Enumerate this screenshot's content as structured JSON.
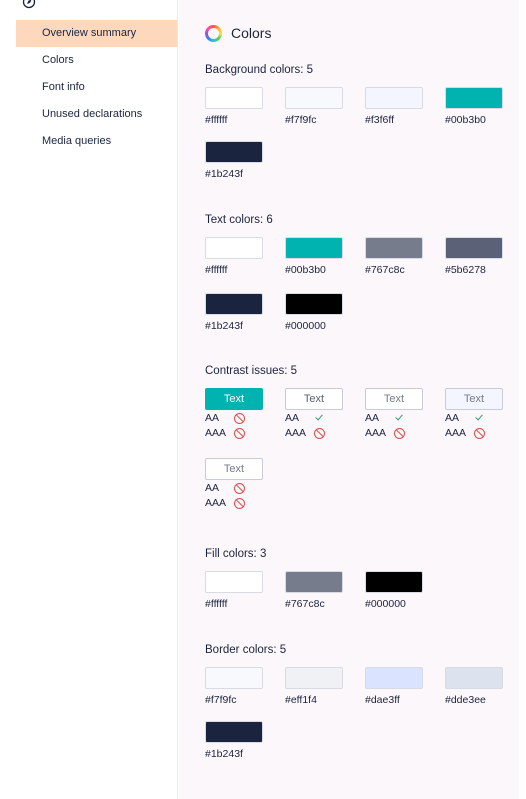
{
  "sidebar": {
    "items": [
      {
        "label": "Overview summary",
        "active": true
      },
      {
        "label": "Colors",
        "active": false
      },
      {
        "label": "Font info",
        "active": false
      },
      {
        "label": "Unused declarations",
        "active": false
      },
      {
        "label": "Media queries",
        "active": false
      }
    ]
  },
  "header": {
    "title": "Colors",
    "icon": "color-wheel-icon"
  },
  "background": {
    "title": "Background colors: 5",
    "colors": [
      {
        "hex": "#ffffff",
        "label": "#ffffff"
      },
      {
        "hex": "#f7f9fc",
        "label": "#f7f9fc"
      },
      {
        "hex": "#f3f6ff",
        "label": "#f3f6ff"
      },
      {
        "hex": "#00b3b0",
        "label": "#00b3b0"
      },
      {
        "hex": "#1b243f",
        "label": "#1b243f"
      }
    ]
  },
  "text": {
    "title": "Text colors: 6",
    "colors": [
      {
        "hex": "#ffffff",
        "label": "#ffffff"
      },
      {
        "hex": "#00b3b0",
        "label": "#00b3b0"
      },
      {
        "hex": "#767c8c",
        "label": "#767c8c"
      },
      {
        "hex": "#5b6278",
        "label": "#5b6278"
      },
      {
        "hex": "#1b243f",
        "label": "#1b243f"
      },
      {
        "hex": "#000000",
        "label": "#000000"
      }
    ]
  },
  "contrast": {
    "title": "Contrast issues: 5",
    "aa_label": "AA",
    "aaa_label": "AAA",
    "items": [
      {
        "text": "Text",
        "fg": "#ffffff",
        "bg": "#00b3b0",
        "border": "#00b3b0",
        "aa": "fail",
        "aaa": "fail"
      },
      {
        "text": "Text",
        "fg": "#5b6278",
        "bg": "#ffffff",
        "border": "#c9ccd6",
        "aa": "pass",
        "aaa": "fail"
      },
      {
        "text": "Text",
        "fg": "#767c8c",
        "bg": "#ffffff",
        "border": "#c9ccd6",
        "aa": "pass",
        "aaa": "fail"
      },
      {
        "text": "Text",
        "fg": "#767c8c",
        "bg": "#f3f6ff",
        "border": "#c9ccd6",
        "aa": "pass",
        "aaa": "fail"
      },
      {
        "text": "Text",
        "fg": "#767c8c",
        "bg": "#ffffff",
        "border": "#c9ccd6",
        "aa": "fail",
        "aaa": "fail"
      }
    ]
  },
  "fill": {
    "title": "Fill colors: 3",
    "colors": [
      {
        "hex": "#ffffff",
        "label": "#ffffff"
      },
      {
        "hex": "#767c8c",
        "label": "#767c8c"
      },
      {
        "hex": "#000000",
        "label": "#000000"
      }
    ]
  },
  "border": {
    "title": "Border colors: 5",
    "colors": [
      {
        "hex": "#f7f9fc",
        "label": "#f7f9fc"
      },
      {
        "hex": "#eff1f4",
        "label": "#eff1f4"
      },
      {
        "hex": "#dae3ff",
        "label": "#dae3ff"
      },
      {
        "hex": "#dde3ee",
        "label": "#dde3ee"
      },
      {
        "hex": "#1b243f",
        "label": "#1b243f"
      }
    ]
  }
}
